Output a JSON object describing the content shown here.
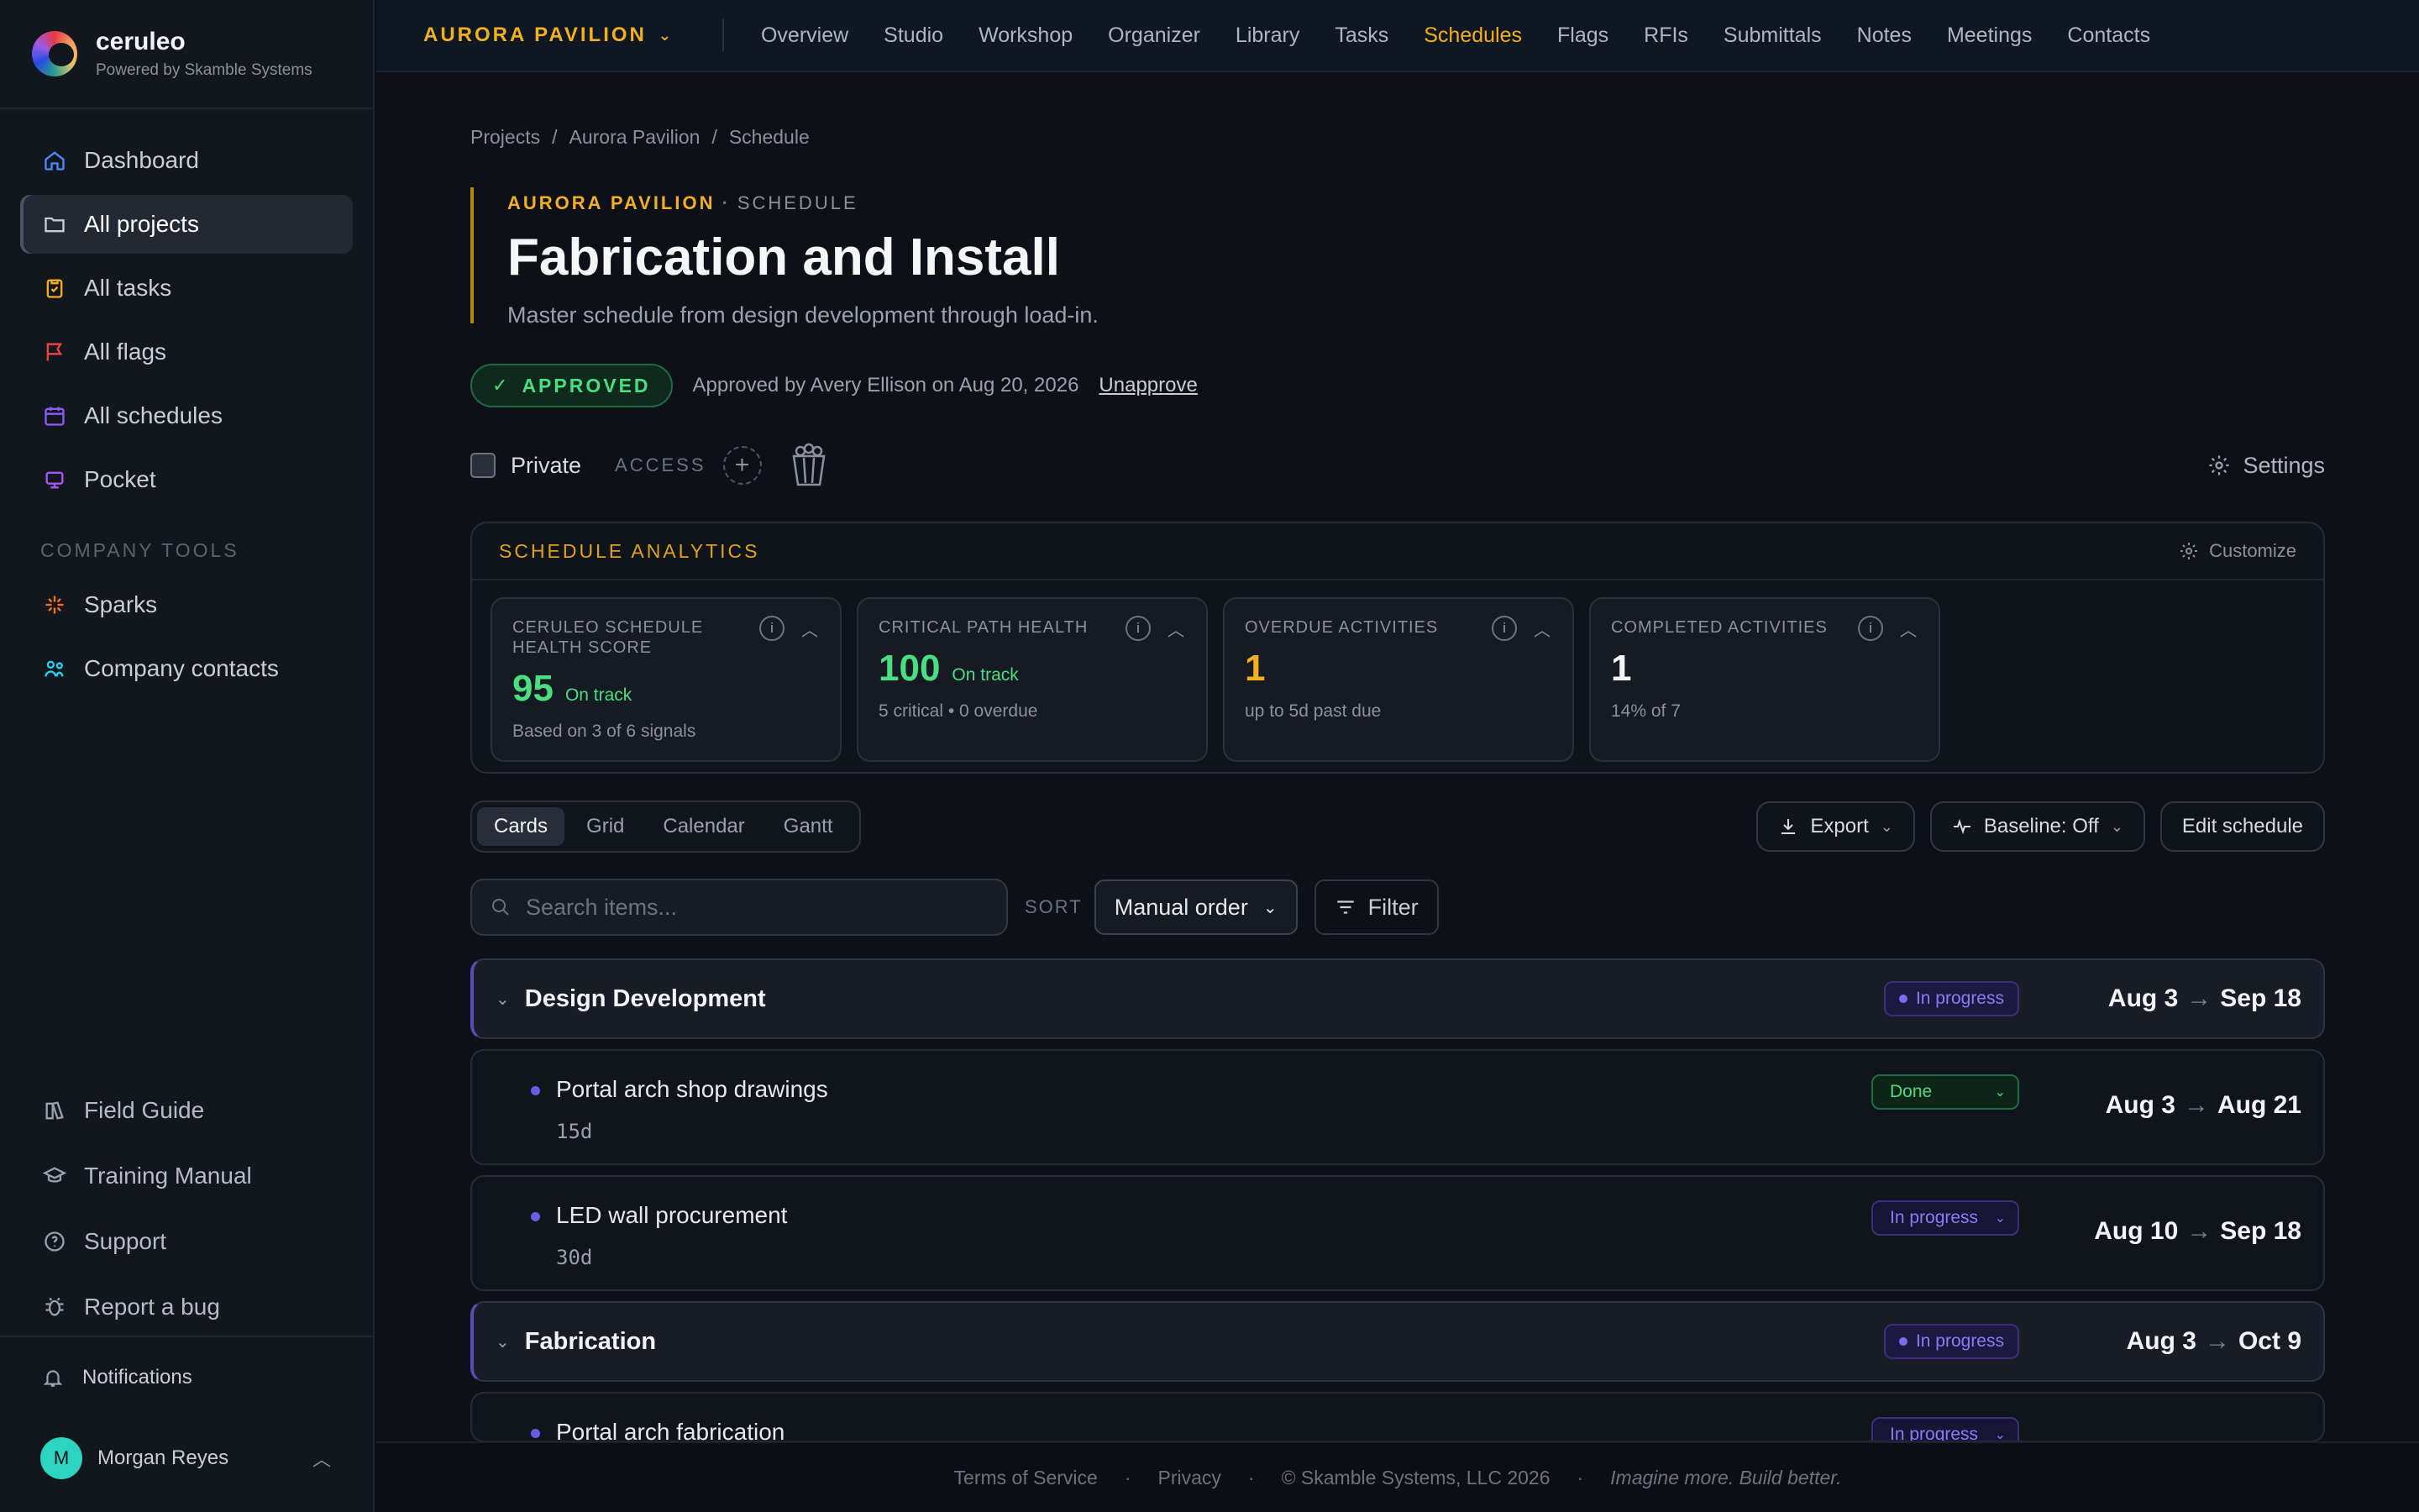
{
  "brand": {
    "name": "ceruleo",
    "sub": "Powered by Skamble Systems"
  },
  "sidebar": {
    "items": [
      {
        "label": "Dashboard",
        "icon": "home-icon",
        "color": "#4a8cff"
      },
      {
        "label": "All projects",
        "icon": "folder-icon",
        "color": "#c9ced6",
        "active": true
      },
      {
        "label": "All tasks",
        "icon": "clipboard-icon",
        "color": "#f2b01e"
      },
      {
        "label": "All flags",
        "icon": "flag-icon",
        "color": "#ef4444"
      },
      {
        "label": "All schedules",
        "icon": "calendar-icon",
        "color": "#8b5cf6"
      },
      {
        "label": "Pocket",
        "icon": "pocket-icon",
        "color": "#a855f7"
      }
    ],
    "section_label": "COMPANY TOOLS",
    "tools": [
      {
        "label": "Sparks",
        "icon": "sparkle-icon",
        "color": "#f97316"
      },
      {
        "label": "Company contacts",
        "icon": "contacts-icon",
        "color": "#22d3ee"
      }
    ],
    "bottom": [
      {
        "label": "Field Guide",
        "icon": "book-icon"
      },
      {
        "label": "Training Manual",
        "icon": "graduation-cap-icon"
      },
      {
        "label": "Support",
        "icon": "support-icon"
      },
      {
        "label": "Report a bug",
        "icon": "bug-icon"
      }
    ],
    "notifications_label": "Notifications",
    "user": {
      "initial": "M",
      "name": "Morgan Reyes"
    }
  },
  "topbar": {
    "project": "AURORA PAVILION",
    "tabs": [
      "Overview",
      "Studio",
      "Workshop",
      "Organizer",
      "Library",
      "Tasks",
      "Schedules",
      "Flags",
      "RFIs",
      "Submittals",
      "Notes",
      "Meetings",
      "Contacts"
    ],
    "active_tab": "Schedules"
  },
  "breadcrumb": [
    "Projects",
    "Aurora Pavilion",
    "Schedule"
  ],
  "header": {
    "eyebrow_project": "AURORA PAVILION",
    "eyebrow_sep": "·",
    "eyebrow_kind": "SCHEDULE",
    "title": "Fabrication and Install",
    "description": "Master schedule from design development through load-in."
  },
  "approval": {
    "badge": "APPROVED",
    "text": "Approved by Avery Ellison on Aug 20, 2026",
    "unapprove": "Unapprove"
  },
  "access": {
    "private_label": "Private",
    "private_checked": false,
    "access_label": "ACCESS",
    "settings_label": "Settings"
  },
  "analytics": {
    "title": "SCHEDULE ANALYTICS",
    "customize": "Customize",
    "metrics": [
      {
        "label": "CERULEO SCHEDULE HEALTH SCORE",
        "value": "95",
        "status": "On track",
        "sub": "Based on 3 of 6 signals",
        "value_color": "#4ade80"
      },
      {
        "label": "CRITICAL PATH HEALTH",
        "value": "100",
        "status": "On track",
        "sub": "5 critical • 0 overdue",
        "value_color": "#4ade80"
      },
      {
        "label": "OVERDUE ACTIVITIES",
        "value": "1",
        "status": "",
        "sub": "up to 5d past due",
        "value_color": "#f2b01e"
      },
      {
        "label": "COMPLETED ACTIVITIES",
        "value": "1",
        "status": "",
        "sub": "14% of 7",
        "value_color": "#f2f4f7"
      }
    ]
  },
  "views": {
    "tabs": [
      "Cards",
      "Grid",
      "Calendar",
      "Gantt"
    ],
    "active": "Cards"
  },
  "actions": {
    "export": "Export",
    "baseline": "Baseline: Off",
    "edit": "Edit schedule"
  },
  "search": {
    "placeholder": "Search items...",
    "value": ""
  },
  "sort": {
    "label": "SORT",
    "value": "Manual order"
  },
  "filter_label": "Filter",
  "schedule": [
    {
      "type": "phase",
      "name": "Design Development",
      "status": "In progress",
      "start": "Aug 3",
      "end": "Sep 18"
    },
    {
      "type": "task",
      "name": "Portal arch shop drawings",
      "duration": "15d",
      "status": "Done",
      "start": "Aug 3",
      "end": "Aug 21"
    },
    {
      "type": "task",
      "name": "LED wall procurement",
      "duration": "30d",
      "status": "In progress",
      "start": "Aug 10",
      "end": "Sep 18"
    },
    {
      "type": "phase",
      "name": "Fabrication",
      "status": "In progress",
      "start": "Aug 3",
      "end": "Oct 9"
    },
    {
      "type": "task",
      "name": "Portal arch fabrication",
      "duration": "",
      "status": "In progress",
      "start": "",
      "end": ""
    }
  ],
  "footer": {
    "terms": "Terms of Service",
    "privacy": "Privacy",
    "copyright": "© Skamble Systems, LLC 2026",
    "tagline": "Imagine more. Build better.",
    "dot": "·"
  }
}
